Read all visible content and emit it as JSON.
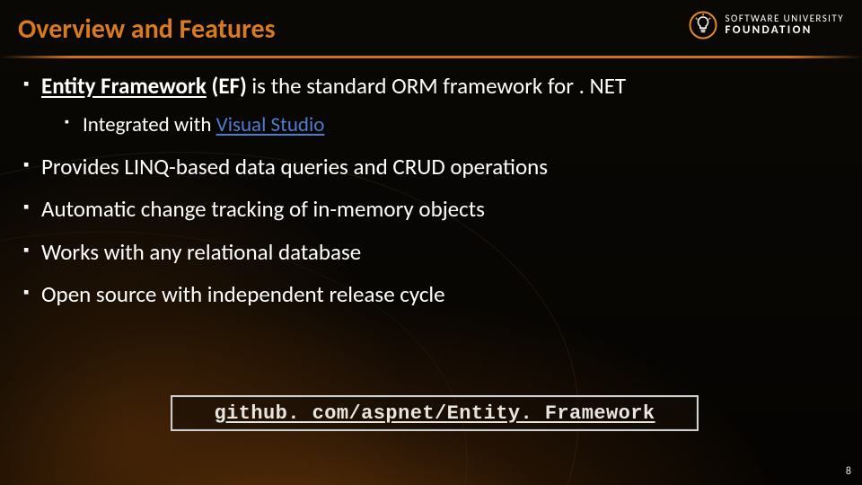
{
  "title": "Overview and Features",
  "logo": {
    "line1": "SOFTWARE UNIVERSITY",
    "line2": "FOUNDATION"
  },
  "bullets": [
    {
      "segments": [
        {
          "text": "Entity Framework",
          "bold": true,
          "underline": true
        },
        {
          "text": " (EF)",
          "bold": true
        },
        {
          "text": " is the standard ORM framework for . NET"
        }
      ],
      "sub": [
        {
          "segments": [
            {
              "text": "Integrated with "
            },
            {
              "text": "Visual Studio",
              "link": true
            }
          ]
        }
      ]
    },
    {
      "segments": [
        {
          "text": "Provides LINQ-based data queries and CRUD operations"
        }
      ]
    },
    {
      "segments": [
        {
          "text": "Automatic change tracking of in-memory objects"
        }
      ]
    },
    {
      "segments": [
        {
          "text": "Works with any relational database"
        }
      ]
    },
    {
      "segments": [
        {
          "text": "Open source with independent release cycle"
        }
      ]
    }
  ],
  "link_box": "github. com/aspnet/Entity. Framework",
  "page_number": "8"
}
